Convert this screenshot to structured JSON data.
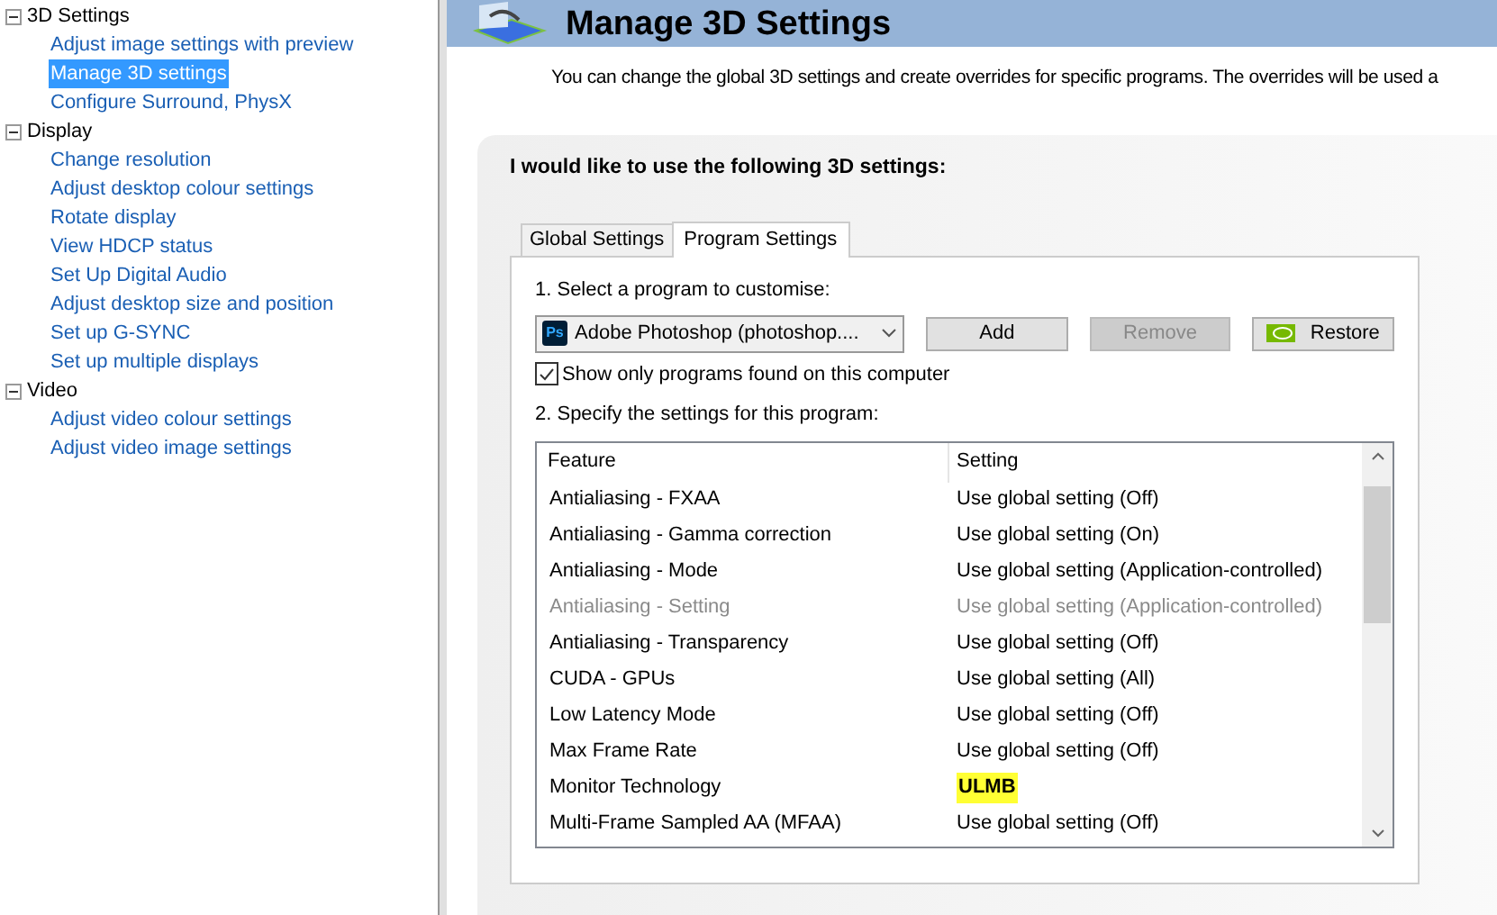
{
  "sidebar": {
    "groups": [
      {
        "label": "3D Settings",
        "expanded": true,
        "children": [
          {
            "label": "Adjust image settings with preview",
            "selected": false
          },
          {
            "label": "Manage 3D settings",
            "selected": true
          },
          {
            "label": "Configure Surround, PhysX",
            "selected": false
          }
        ]
      },
      {
        "label": "Display",
        "expanded": true,
        "children": [
          {
            "label": "Change resolution",
            "selected": false
          },
          {
            "label": "Adjust desktop colour settings",
            "selected": false
          },
          {
            "label": "Rotate display",
            "selected": false
          },
          {
            "label": "View HDCP status",
            "selected": false
          },
          {
            "label": "Set Up Digital Audio",
            "selected": false
          },
          {
            "label": "Adjust desktop size and position",
            "selected": false
          },
          {
            "label": "Set up G-SYNC",
            "selected": false
          },
          {
            "label": "Set up multiple displays",
            "selected": false
          }
        ]
      },
      {
        "label": "Video",
        "expanded": true,
        "children": [
          {
            "label": "Adjust video colour settings",
            "selected": false
          },
          {
            "label": "Adjust video image settings",
            "selected": false
          }
        ]
      }
    ]
  },
  "header": {
    "title": "Manage 3D Settings"
  },
  "description": "You can change the global 3D settings and create overrides for specific programs. The overrides will be used a",
  "panel": {
    "title": "I would like to use the following 3D settings:",
    "tabs": [
      {
        "label": "Global Settings",
        "selected": false
      },
      {
        "label": "Program Settings",
        "selected": true
      }
    ],
    "step1": "1. Select a program to customise:",
    "program": {
      "icon_text": "Ps",
      "value": "Adobe Photoshop (photoshop...."
    },
    "buttons": [
      {
        "label": "Add",
        "disabled": false,
        "kind": "plain"
      },
      {
        "label": "Remove",
        "disabled": true,
        "kind": "plain"
      },
      {
        "label": "Restore",
        "disabled": false,
        "kind": "logo"
      }
    ],
    "show_only": {
      "label": "Show only programs found on this computer",
      "checked": true
    },
    "step2": "2. Specify the settings for this program:",
    "table": {
      "columns": [
        "Feature",
        "Setting"
      ],
      "rows": [
        {
          "feature": "Antialiasing - FXAA",
          "setting": "Use global setting (Off)",
          "disabled": false,
          "highlighted": false
        },
        {
          "feature": "Antialiasing - Gamma correction",
          "setting": "Use global setting (On)",
          "disabled": false,
          "highlighted": false
        },
        {
          "feature": "Antialiasing - Mode",
          "setting": "Use global setting (Application-controlled)",
          "disabled": false,
          "highlighted": false
        },
        {
          "feature": "Antialiasing - Setting",
          "setting": "Use global setting (Application-controlled)",
          "disabled": true,
          "highlighted": false
        },
        {
          "feature": "Antialiasing - Transparency",
          "setting": "Use global setting (Off)",
          "disabled": false,
          "highlighted": false
        },
        {
          "feature": "CUDA - GPUs",
          "setting": "Use global setting (All)",
          "disabled": false,
          "highlighted": false
        },
        {
          "feature": "Low Latency Mode",
          "setting": "Use global setting (Off)",
          "disabled": false,
          "highlighted": false
        },
        {
          "feature": "Max Frame Rate",
          "setting": "Use global setting (Off)",
          "disabled": false,
          "highlighted": false
        },
        {
          "feature": "Monitor Technology",
          "setting": "ULMB",
          "disabled": false,
          "highlighted": true
        },
        {
          "feature": "Multi-Frame Sampled AA (MFAA)",
          "setting": "Use global setting (Off)",
          "disabled": false,
          "highlighted": false
        }
      ]
    }
  }
}
